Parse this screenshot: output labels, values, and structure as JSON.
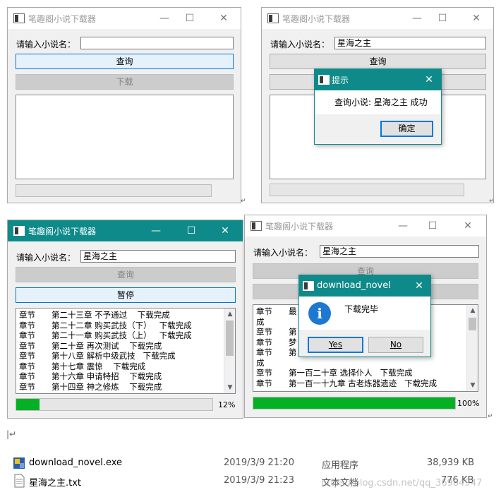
{
  "app_title": "笔趣阁小说下载器",
  "controls": {
    "minimize": "—",
    "maximize": "☐",
    "close": "✕"
  },
  "search_label": "请输入小说名：",
  "buttons": {
    "query": "查询",
    "download": "下载",
    "pause": "暂停"
  },
  "novel_name": "星海之主",
  "win2_dialog": {
    "title": "提示",
    "message": "查询小说: 星海之主 成功",
    "ok": "确定"
  },
  "win3": {
    "rows": [
      [
        "章节",
        "第二十三章 不予通过    下载完成"
      ],
      [
        "章节",
        "第二十二章 购买武技（下）   下载完成"
      ],
      [
        "章节",
        "第二十一章 购买武技（上）   下载完成"
      ],
      [
        "章节",
        "第二十章 再次测试    下载完成"
      ],
      [
        "章节",
        "第十八章 解析中级武技   下载完成"
      ],
      [
        "章节",
        "第十七章 震惊    下载完成"
      ],
      [
        "章节",
        "第十六章 申请特招    下载完成"
      ],
      [
        "章节",
        "第十四章 神之修炼    下载完成"
      ]
    ],
    "progress": 0.12,
    "progress_text": "12%"
  },
  "win4": {
    "rows": [
      [
        "章节",
        "最                                    下载完"
      ],
      [
        "成",
        ""
      ],
      [
        "章节",
        "第                               成"
      ],
      [
        "章节",
        "梦"
      ],
      [
        "章节",
        "第                                    下载完"
      ],
      [
        "成",
        ""
      ],
      [
        "章节",
        "第一百二十章 选择仆人   下载完成"
      ],
      [
        "章节",
        "第一百一十九章 古老炼器遗迹   下载完成"
      ]
    ],
    "progress": 1.0,
    "progress_text": "100%"
  },
  "win4_dialog": {
    "title": "download_novel",
    "message": "下载完毕",
    "yes": "Yes",
    "no": "No"
  },
  "files": [
    {
      "name": "download_novel.exe",
      "date": "2019/3/9 21:20",
      "type": "应用程序",
      "size": "38,939 KB"
    },
    {
      "name": "星海之主.txt",
      "date": "2019/3/9 21:23",
      "type": "文本文档",
      "size": "776 KB"
    }
  ],
  "watermark": "https://blog.csdn.net/qq_36984947",
  "colors": {
    "teal": "#0f8a8a",
    "progress": "#06b025",
    "focus": "#0078d7"
  }
}
